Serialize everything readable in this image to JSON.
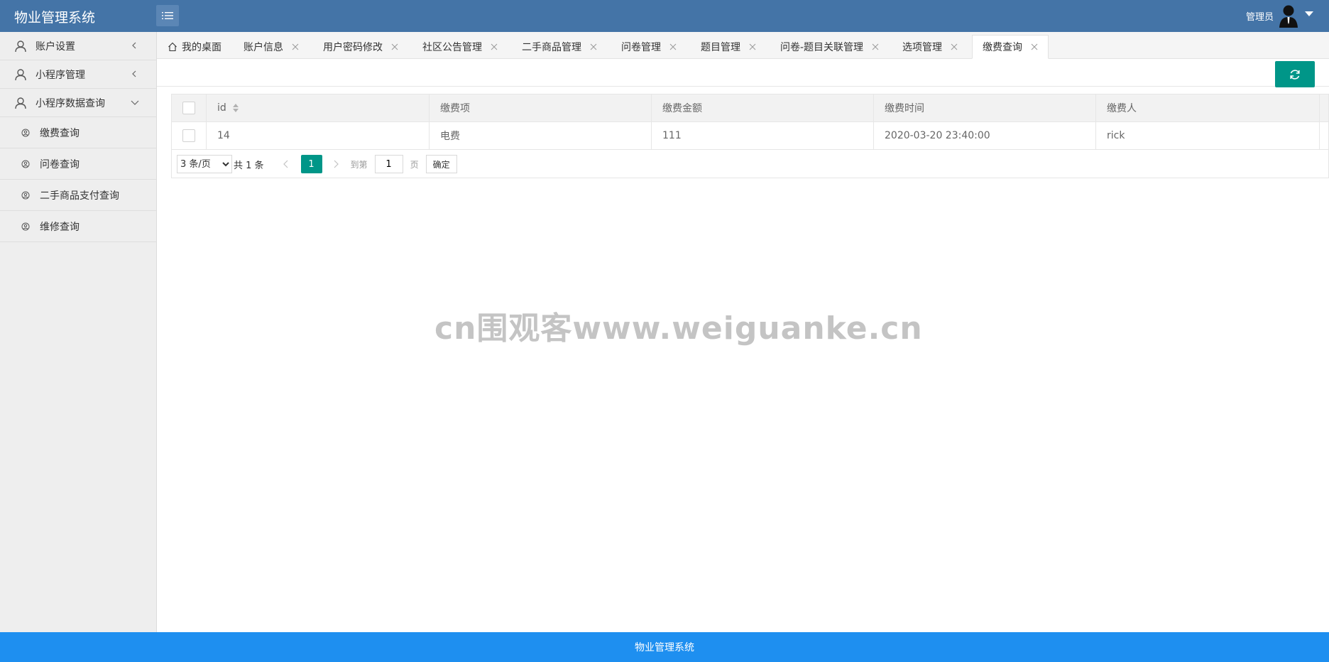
{
  "header": {
    "title": "物业管理系统",
    "user_name": "管理员",
    "menu_icon": "list-icon"
  },
  "sidebar": {
    "items": [
      {
        "label": "账户设置",
        "icon": "user-icon",
        "expanded": false
      },
      {
        "label": "小程序管理",
        "icon": "user-icon",
        "expanded": false
      },
      {
        "label": "小程序数据查询",
        "icon": "user-icon",
        "expanded": true
      }
    ],
    "sub_items": [
      {
        "label": "缴费查询"
      },
      {
        "label": "问卷查询"
      },
      {
        "label": "二手商品支付查询"
      },
      {
        "label": "维修查询"
      }
    ]
  },
  "tabs": [
    {
      "label": "我的桌面",
      "closable": false
    },
    {
      "label": "账户信息",
      "closable": true
    },
    {
      "label": "用户密码修改",
      "closable": true
    },
    {
      "label": "社区公告管理",
      "closable": true
    },
    {
      "label": "二手商品管理",
      "closable": true
    },
    {
      "label": "问卷管理",
      "closable": true
    },
    {
      "label": "题目管理",
      "closable": true
    },
    {
      "label": "问卷-题目关联管理",
      "closable": true
    },
    {
      "label": "选项管理",
      "closable": true
    },
    {
      "label": "缴费查询",
      "closable": true,
      "active": true
    }
  ],
  "table": {
    "columns": [
      "id",
      "缴费项",
      "缴费金额",
      "缴费时间",
      "缴费人"
    ],
    "rows": [
      {
        "id": "14",
        "item": "电费",
        "amount": "111",
        "time": "2020-03-20 23:40:00",
        "payer": "rick"
      }
    ]
  },
  "pagination": {
    "page_size_option": "3 条/页",
    "total_text": "共 1 条",
    "current_page": "1",
    "goto_label": "到第",
    "goto_value": "1",
    "page_label": "页",
    "confirm_label": "确定"
  },
  "watermark": "cn围观客www.weiguanke.cn",
  "footer": {
    "text": "物业管理系统"
  },
  "colors": {
    "header_bg": "#4474a7",
    "accent": "#009688",
    "footer_bg": "#1e8ff0"
  }
}
